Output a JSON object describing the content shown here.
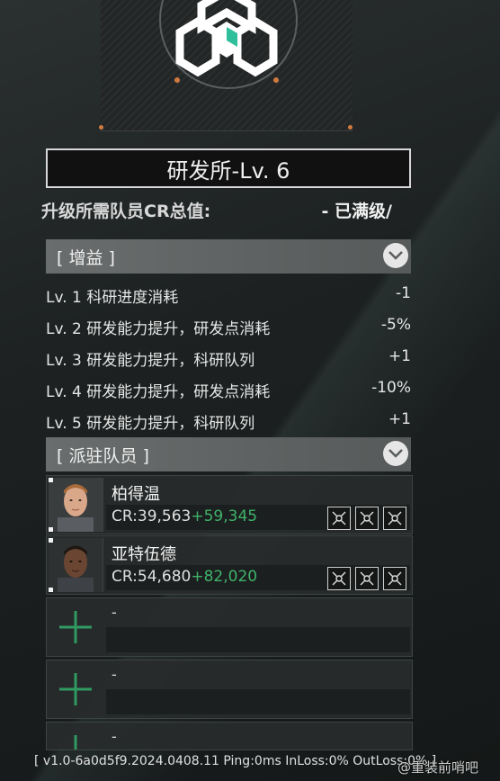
{
  "building": {
    "title": "研发所-Lv. 6",
    "requirement_label": "升级所需队员CR总值:",
    "requirement_value": "- 已满级/"
  },
  "buffs": {
    "header": "[ 增益 ]",
    "items": [
      {
        "text": "Lv. 1 科研进度消耗",
        "value": "-1"
      },
      {
        "text": "Lv. 2 研发能力提升，研发点消耗",
        "value": "-5%"
      },
      {
        "text": "Lv. 3 研发能力提升，科研队列",
        "value": "+1"
      },
      {
        "text": "Lv. 4 研发能力提升，研发点消耗",
        "value": "-10%"
      },
      {
        "text": "Lv. 5 研发能力提升，科研队列",
        "value": "+1"
      }
    ]
  },
  "members": {
    "header": "[ 派驻队员 ]",
    "list": [
      {
        "name": "柏得温",
        "cr": "CR:39,563",
        "bonus": "+59,345"
      },
      {
        "name": "亚特伍德",
        "cr": "CR:54,680",
        "bonus": "+82,020"
      }
    ],
    "empty_slots": [
      "-",
      "-",
      "-"
    ]
  },
  "status": {
    "text": "[ v1.0-6a0d5f9.2024.0408.11  Ping:0ms  InLoss:0%  OutLoss:0% ]"
  },
  "watermark": "@重装前哨吧",
  "colors": {
    "accent_green": "#3fb36a",
    "emblem_teal": "#2fbf9a",
    "emblem_orange": "#d07a40",
    "header_bg": "#6a6d6d"
  },
  "icons": {
    "collapse": "chevron-down-icon",
    "skill": "skill-node-icon",
    "add": "plus-icon"
  }
}
